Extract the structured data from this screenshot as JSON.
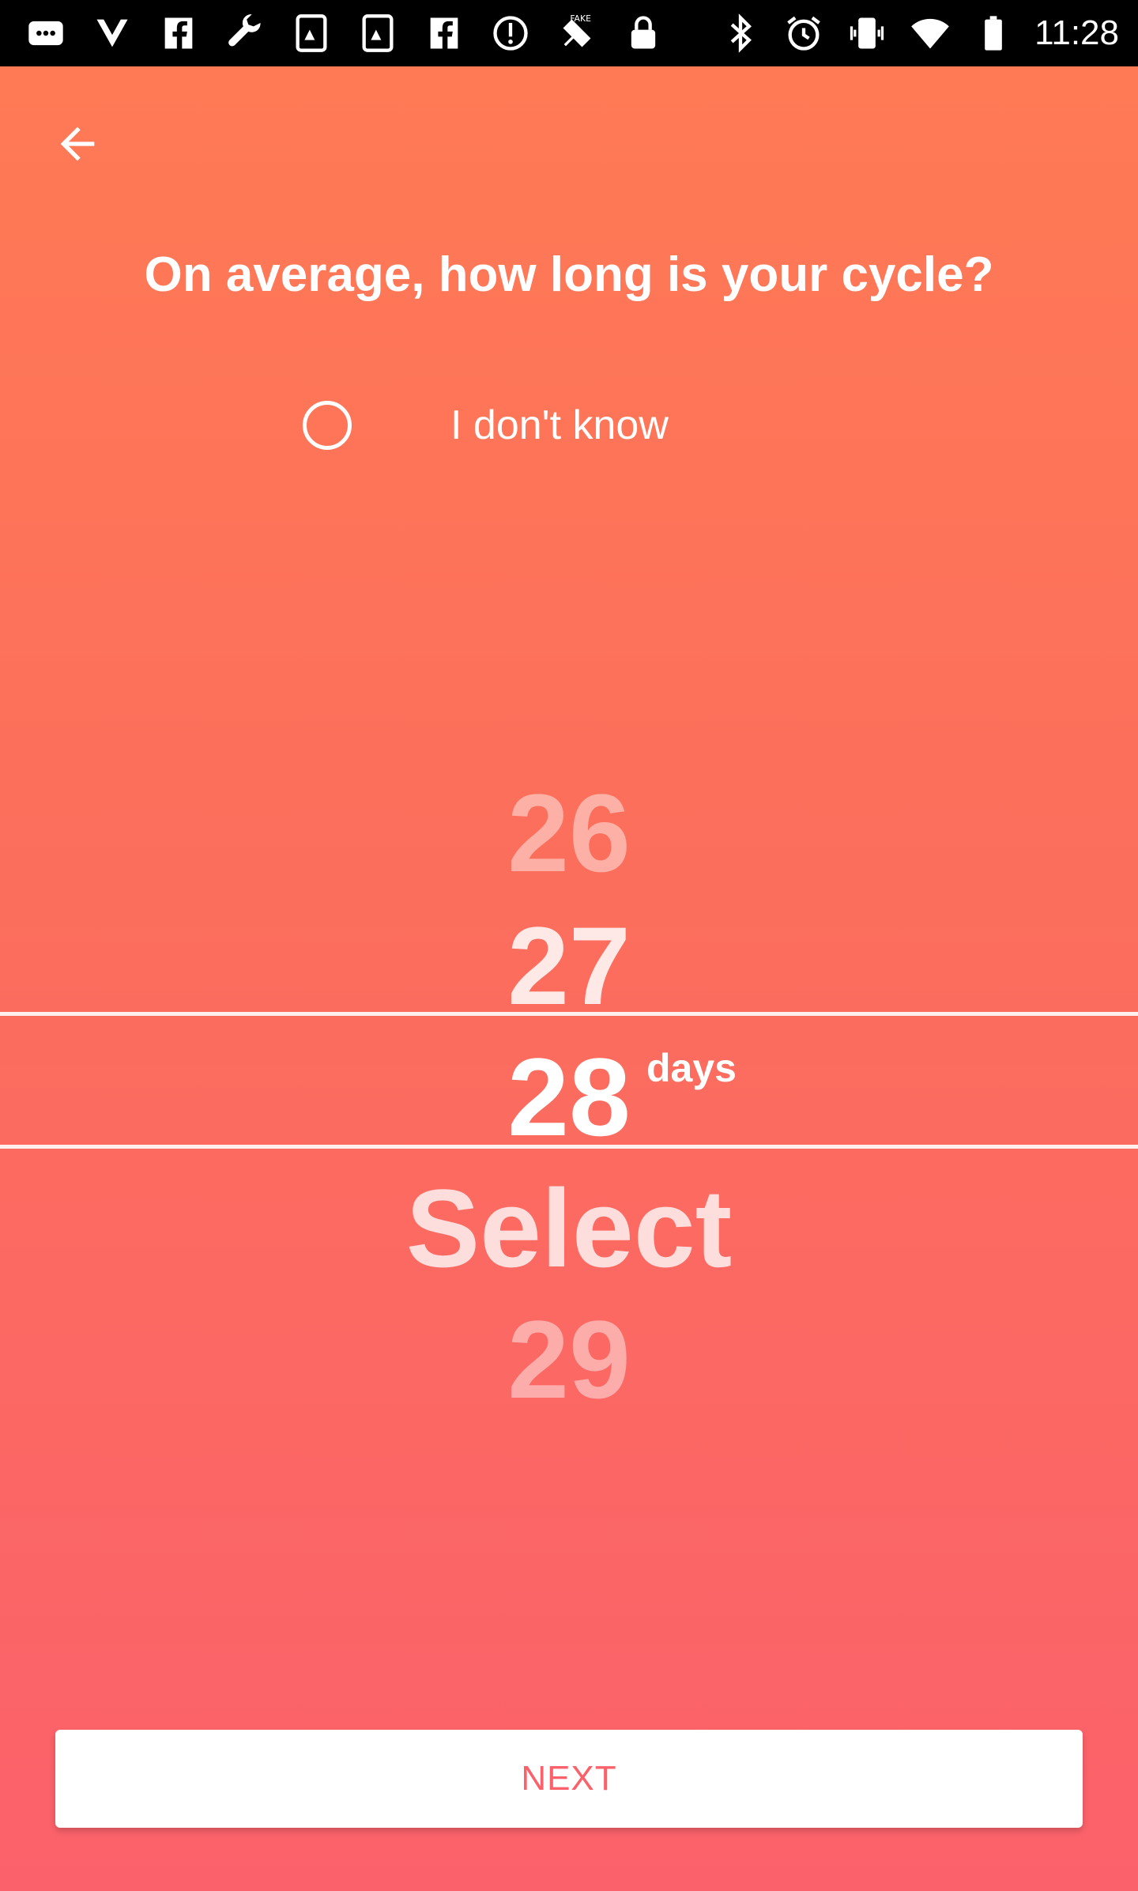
{
  "status_bar": {
    "time": "11:28",
    "icons_left": [
      "message-icon",
      "vpn-icon",
      "facebook-icon",
      "wrench-icon",
      "app-icon",
      "app-icon",
      "facebook-icon",
      "sync-icon",
      "fake-gps-icon",
      "lock-icon"
    ],
    "icons_right": [
      "bluetooth-icon",
      "alarm-icon",
      "vibrate-icon",
      "wifi-icon",
      "battery-icon"
    ]
  },
  "header": {
    "back_icon": "arrow-left-icon"
  },
  "question": {
    "title": "On average, how long is your cycle?"
  },
  "dont_know": {
    "label": "I don't know",
    "checked": false
  },
  "picker": {
    "items": [
      "26",
      "27",
      "28",
      "Select",
      "29"
    ],
    "selected": "28",
    "unit": "days"
  },
  "actions": {
    "next_label": "NEXT"
  },
  "colors": {
    "gradient_top": "#FF7A55",
    "gradient_bottom": "#FB616B",
    "accent": "#FB616B"
  }
}
